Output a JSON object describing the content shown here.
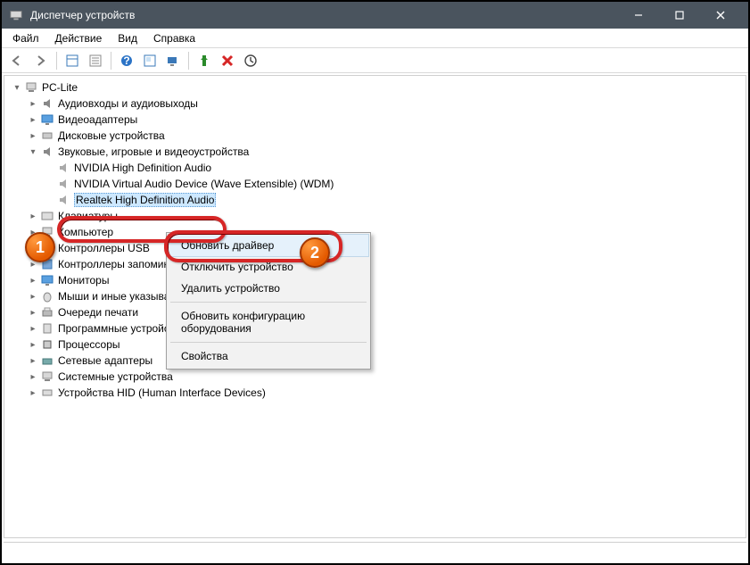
{
  "window": {
    "title": "Диспетчер устройств"
  },
  "menubar": {
    "file": "Файл",
    "action": "Действие",
    "view": "Вид",
    "help": "Справка"
  },
  "tree": {
    "root": "PC-Lite",
    "audio_io": "Аудиовходы и аудиовыходы",
    "video_adapters": "Видеоадаптеры",
    "disk_drives": "Дисковые устройства",
    "sound_video_game": "Звуковые, игровые и видеоустройства",
    "svg_children": {
      "nvidia": "NVIDIA High Definition Audio",
      "nvidia_virt": "NVIDIA Virtual Audio Device (Wave Extensible) (WDM)",
      "realtek": "Realtek High Definition Audio"
    },
    "keyboards": "Клавиатуры",
    "computer": "Компьютер",
    "usb_controllers": "Контроллеры USB",
    "storage_controllers": "Контроллеры запоминающих устройств",
    "monitors": "Мониторы",
    "mice": "Мыши и иные указывающие устройства",
    "print_queues": "Очереди печати",
    "software_devices": "Программные устройства",
    "processors": "Процессоры",
    "network_adapters": "Сетевые адаптеры",
    "system_devices": "Системные устройства",
    "hid": "Устройства HID (Human Interface Devices)"
  },
  "context_menu": {
    "update": "Обновить драйвер",
    "disable": "Отключить устройство",
    "uninstall": "Удалить устройство",
    "scan": "Обновить конфигурацию оборудования",
    "properties": "Свойства"
  },
  "badges": {
    "one": "1",
    "two": "2"
  }
}
